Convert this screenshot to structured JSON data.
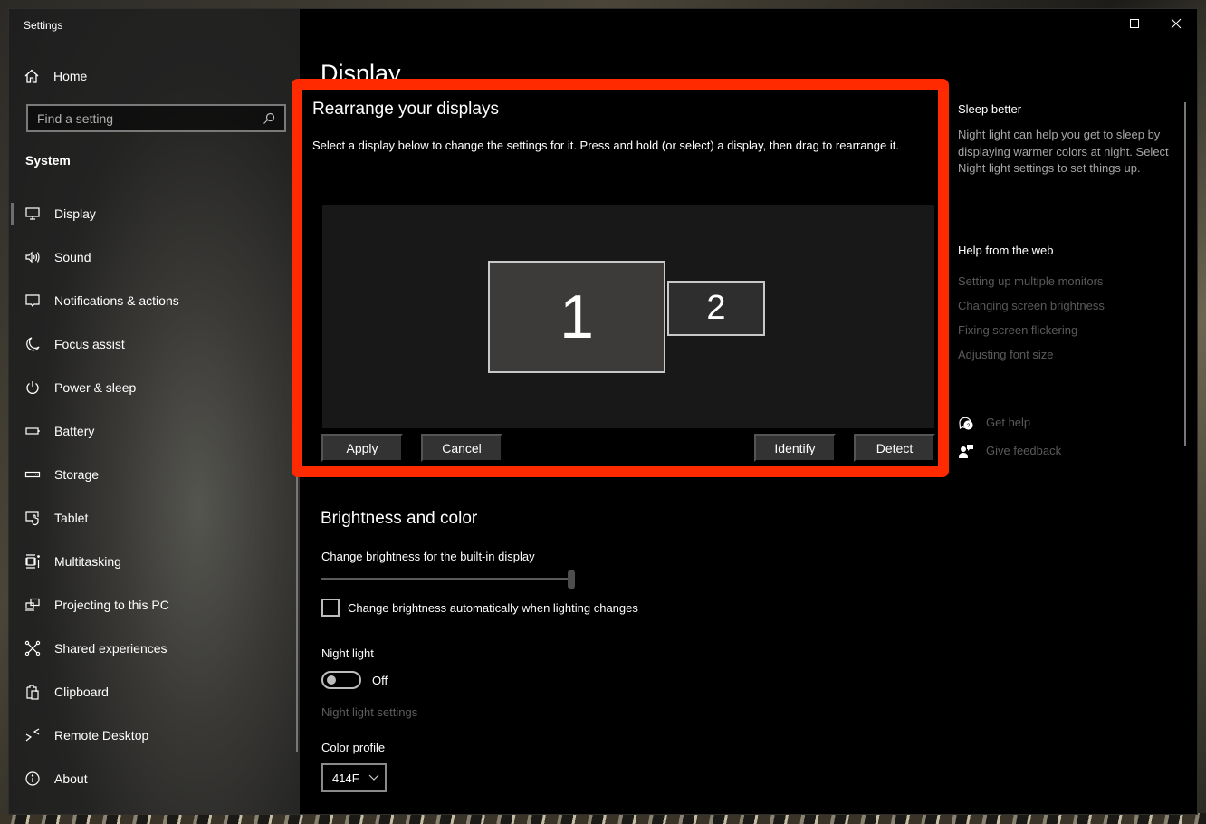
{
  "window": {
    "app_title": "Settings",
    "caption": {
      "minimize": "minimize-icon",
      "maximize": "maximize-icon",
      "close": "close-icon"
    }
  },
  "sidebar": {
    "home_label": "Home",
    "search_placeholder": "Find a setting",
    "section_title": "System",
    "items": [
      {
        "label": "Display",
        "icon": "monitor-icon",
        "active": true
      },
      {
        "label": "Sound",
        "icon": "speaker-icon"
      },
      {
        "label": "Notifications & actions",
        "icon": "notification-icon"
      },
      {
        "label": "Focus assist",
        "icon": "moon-icon"
      },
      {
        "label": "Power & sleep",
        "icon": "power-icon"
      },
      {
        "label": "Battery",
        "icon": "battery-icon"
      },
      {
        "label": "Storage",
        "icon": "storage-icon"
      },
      {
        "label": "Tablet",
        "icon": "tablet-icon"
      },
      {
        "label": "Multitasking",
        "icon": "multitasking-icon"
      },
      {
        "label": "Projecting to this PC",
        "icon": "projecting-icon"
      },
      {
        "label": "Shared experiences",
        "icon": "shared-icon"
      },
      {
        "label": "Clipboard",
        "icon": "clipboard-icon"
      },
      {
        "label": "Remote Desktop",
        "icon": "remote-desktop-icon"
      },
      {
        "label": "About",
        "icon": "info-icon"
      }
    ]
  },
  "main": {
    "page_title": "Display",
    "highlight_color": "#ff2a00",
    "rearrange": {
      "title": "Rearrange your displays",
      "description": "Select a display below to change the settings for it. Press and hold (or select) a display, then drag to rearrange it.",
      "monitors": [
        "1",
        "2"
      ],
      "buttons": {
        "apply": "Apply",
        "cancel": "Cancel",
        "identify": "Identify",
        "detect": "Detect"
      }
    },
    "brightness": {
      "title": "Brightness and color",
      "slider_label": "Change brightness for the built-in display",
      "slider_value_percent": 100,
      "auto_checkbox_label": "Change brightness automatically when lighting changes",
      "auto_checked": false,
      "night_light_label": "Night light",
      "night_light_state": "Off",
      "night_light_settings_link": "Night light settings",
      "color_profile_label": "Color profile",
      "color_profile_value": "414F"
    }
  },
  "right_panel": {
    "sleep_title": "Sleep better",
    "sleep_desc": "Night light can help you get to sleep by displaying warmer colors at night. Select Night light settings to set things up.",
    "help_title": "Help from the web",
    "links": [
      "Setting up multiple monitors",
      "Changing screen brightness",
      "Fixing screen flickering",
      "Adjusting font size"
    ],
    "get_help": "Get help",
    "give_feedback": "Give feedback"
  }
}
